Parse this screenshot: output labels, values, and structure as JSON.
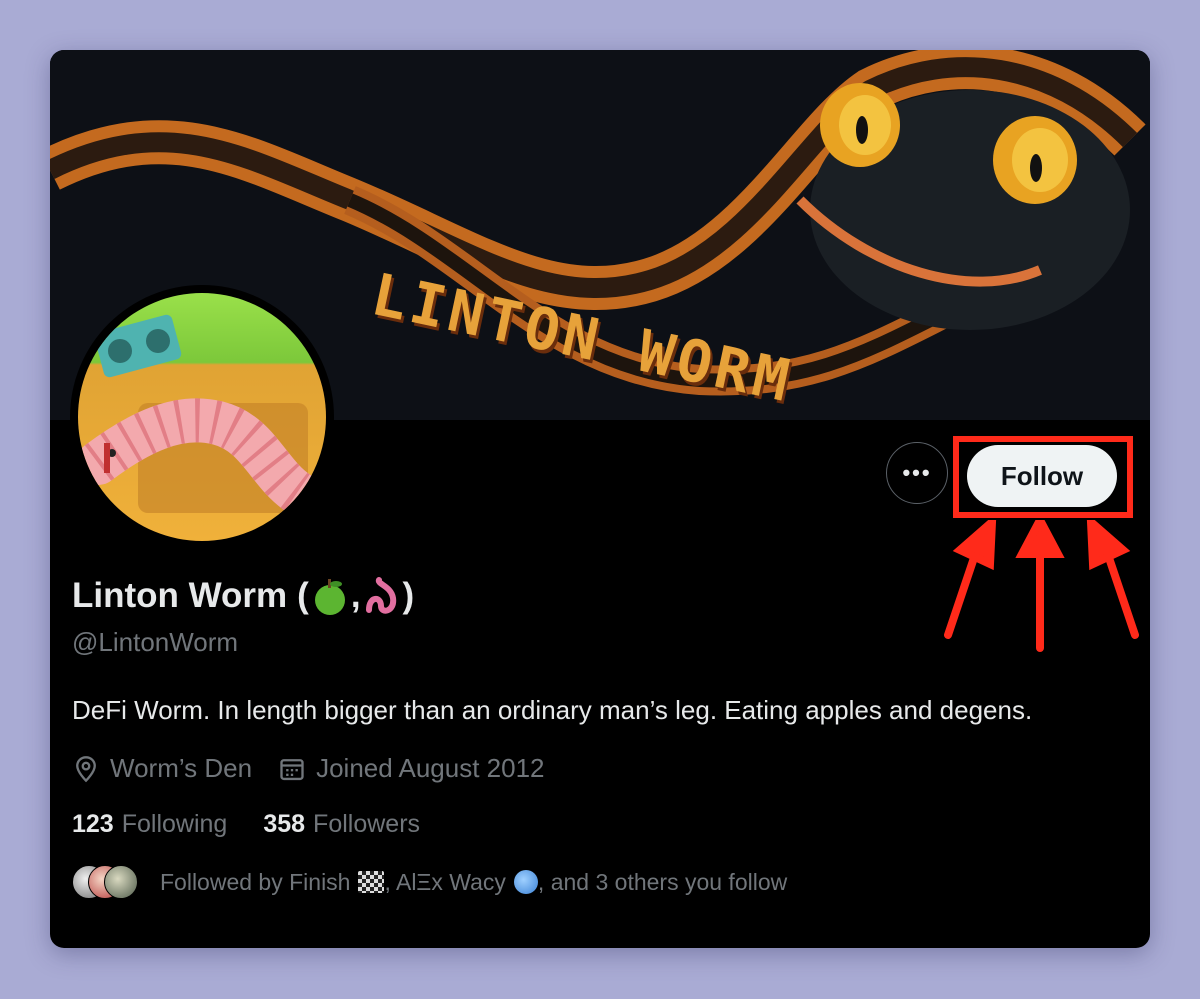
{
  "banner": {
    "title": "LINTON WORM"
  },
  "profile": {
    "name": "Linton Worm",
    "name_open": "(",
    "name_sep": ",",
    "name_close": ")",
    "handle": "@LintonWorm",
    "bio": "DeFi Worm. In length bigger than an ordinary man’s leg. Eating apples and degens.",
    "location": "Worm’s Den",
    "joined": "Joined August 2012",
    "following_count": "123",
    "following_label": "Following",
    "followers_count": "358",
    "followers_label": "Followers",
    "followed_by": {
      "prefix": "Followed by Finish",
      "middle": ", AlΞx Wacy",
      "suffix": ", and 3 others you follow"
    }
  },
  "actions": {
    "more_label": "•••",
    "follow_label": "Follow"
  },
  "icons": [
    "apple-emoji-icon",
    "worm-emoji-icon",
    "location-pin-icon",
    "calendar-icon",
    "checkered-flag-icon",
    "globe-icon",
    "more-icon"
  ],
  "colors": {
    "background": "#a9abd4",
    "card": "#000000",
    "text_primary": "#e7e9ea",
    "text_secondary": "#71767b",
    "follow_button": "#eff3f4",
    "highlight": "#ff2a1a"
  }
}
